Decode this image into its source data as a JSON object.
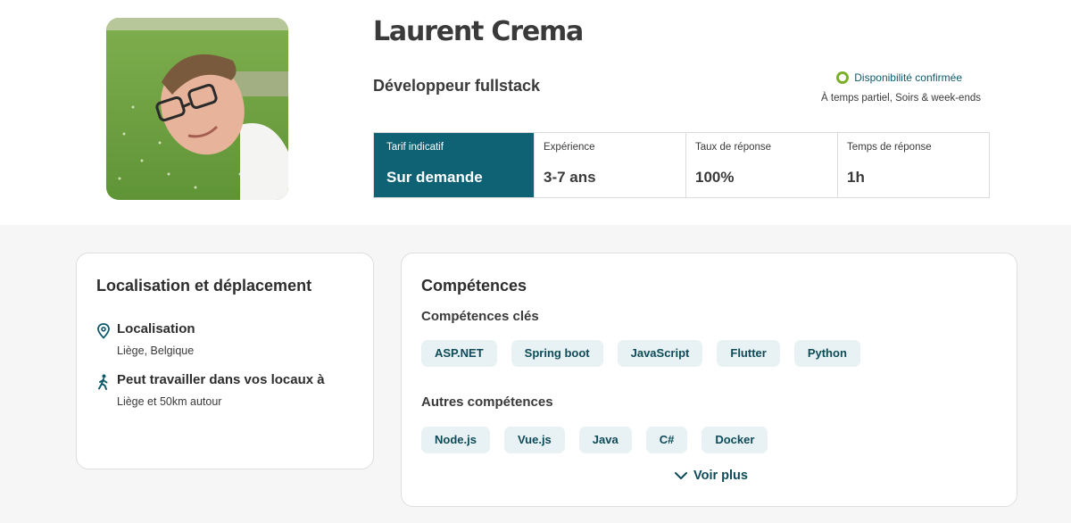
{
  "profile": {
    "name": "Laurent Crema",
    "role": "Développeur fullstack",
    "availability": "Disponibilité confirmée",
    "availability_detail": "À temps partiel, Soirs & week-ends"
  },
  "stats": [
    {
      "label": "Tarif indicatif",
      "value": "Sur demande"
    },
    {
      "label": "Expérience",
      "value": "3-7 ans"
    },
    {
      "label": "Taux de réponse",
      "value": "100%"
    },
    {
      "label": "Temps de réponse",
      "value": "1h"
    }
  ],
  "location_card": {
    "title": "Localisation et déplacement",
    "location_label": "Localisation",
    "location_value": "Liège, Belgique",
    "onsite_label": "Peut travailler dans vos locaux à",
    "onsite_value": "Liège et 50km autour"
  },
  "skills_card": {
    "title": "Compétences",
    "key_label": "Compétences clés",
    "key_skills": [
      "ASP.NET",
      "Spring boot",
      "JavaScript",
      "Flutter",
      "Python"
    ],
    "other_label": "Autres compétences",
    "other_skills": [
      "Node.js",
      "Vue.js",
      "Java",
      "C#",
      "Docker"
    ],
    "more_label": "Voir plus"
  },
  "colors": {
    "accent": "#0e6274",
    "chip_bg": "#e8f1f3",
    "availability": "#7cb02a"
  }
}
